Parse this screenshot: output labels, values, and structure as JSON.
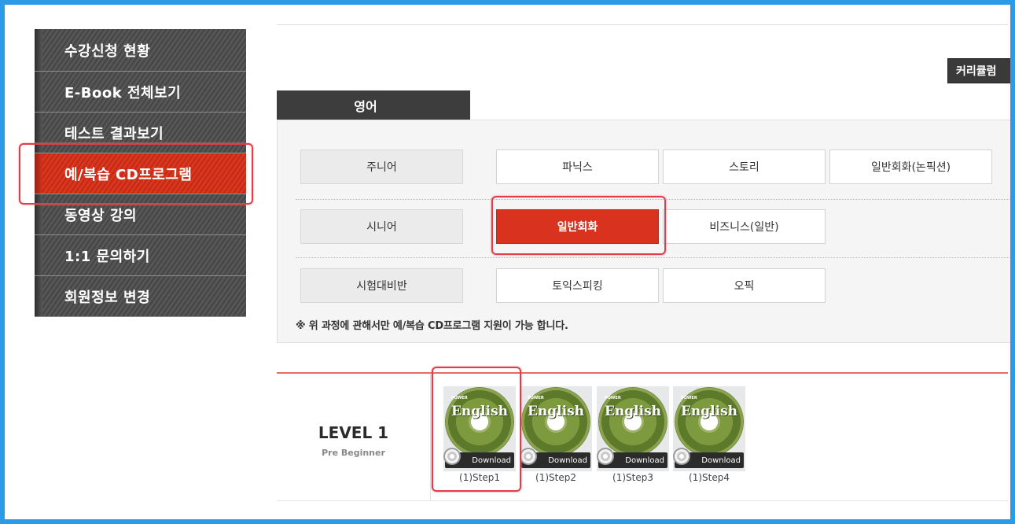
{
  "sidebar": {
    "items": [
      {
        "label": "수강신청 현황"
      },
      {
        "label": "E-Book 전체보기"
      },
      {
        "label": "테스트 결과보기"
      },
      {
        "label": "예/복습 CD프로그램",
        "active": true
      },
      {
        "label": "동영상 강의"
      },
      {
        "label": "1:1 문의하기"
      },
      {
        "label": "회원정보 변경"
      }
    ]
  },
  "header": {
    "curriculum_button": "커리큘럼"
  },
  "tabs": {
    "active": "영어"
  },
  "course_rows": [
    {
      "category": "주니어",
      "options": [
        "파닉스",
        "스토리",
        "일반회화(논픽션)"
      ]
    },
    {
      "category": "시니어",
      "options": [
        "일반회화",
        "비즈니스(일반)"
      ],
      "selected": "일반회화"
    },
    {
      "category": "시험대비반",
      "options": [
        "토익스피킹",
        "오픽"
      ]
    }
  ],
  "note": "※ 위 과정에 관해서만 예/복습 CD프로그램 지원이 가능 합니다.",
  "level": {
    "title": "LEVEL 1",
    "subtitle": "Pre Beginner",
    "cd_title": "English",
    "cd_brand": "POWER",
    "download_label": "Download",
    "steps": [
      "(1)Step1",
      "(1)Step2",
      "(1)Step3",
      "(1)Step4"
    ]
  },
  "colors": {
    "accent": "#d9331f",
    "frame": "#2b9be8",
    "sidebar_bg": "#505050",
    "highlight": "#e23b4a"
  }
}
